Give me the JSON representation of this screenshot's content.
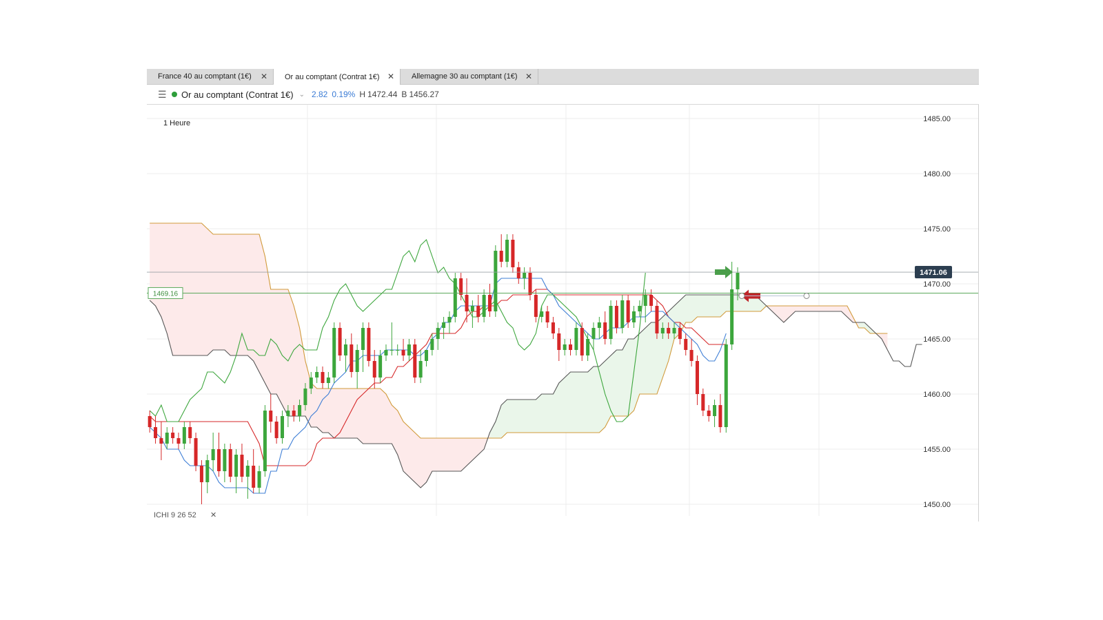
{
  "tabs": [
    {
      "label": "France 40 au comptant (1€)",
      "close": "✕",
      "active": false
    },
    {
      "label": "Or au comptant (Contrat 1€)",
      "close": "✕",
      "active": true
    },
    {
      "label": "Allemagne 30 au comptant (1€)",
      "close": "✕",
      "active": false
    }
  ],
  "header": {
    "menu_icon": "☰",
    "instrument": "Or au comptant (Contrat 1€)",
    "chevron": "⌄",
    "change": "2.82",
    "change_pct": "0.19%",
    "high_label": "H",
    "high": "1472.44",
    "low_label": "B",
    "low": "1456.27"
  },
  "timeframe": "1 Heure",
  "indicator": {
    "label": "ICHI 9 26 52",
    "close": "✕"
  },
  "chart_data": {
    "type": "candlestick",
    "ylim": [
      1450,
      1485
    ],
    "y_ticks": [
      "1485.00",
      "1480.00",
      "1475.00",
      "1470.00",
      "1465.00",
      "1460.00",
      "1455.00",
      "1450.00"
    ],
    "y_tick_values": [
      1485,
      1480,
      1475,
      1470,
      1465,
      1460,
      1455,
      1450
    ],
    "current_price": 1471.06,
    "current_price_label": "1471.06",
    "horizontal_line": 1469.16,
    "horizontal_line_label": "1469.16",
    "colors": {
      "up": "#3ca63c",
      "down": "#d62728",
      "tenkan": "#3f7fd6",
      "kijun": "#d62728",
      "chikou": "#3ca63c",
      "senkou_a": "#d19a3a",
      "senkou_b": "#555555",
      "cloud_bull": "#e8f5e8",
      "cloud_bear": "#fde8e8",
      "price_tag": "#2c3e50",
      "arrow_up": "#4a9e4a",
      "arrow_down": "#c0262b"
    },
    "candles": [
      [
        1458.0,
        1458.5,
        1456.5,
        1457.0
      ],
      [
        1457.0,
        1458.0,
        1455.5,
        1456.0
      ],
      [
        1456.0,
        1457.5,
        1454.0,
        1455.5
      ],
      [
        1455.5,
        1457.0,
        1455.0,
        1456.5
      ],
      [
        1456.5,
        1457.0,
        1455.5,
        1456.0
      ],
      [
        1456.0,
        1456.5,
        1455.0,
        1455.5
      ],
      [
        1455.5,
        1457.5,
        1455.0,
        1457.0
      ],
      [
        1457.0,
        1457.5,
        1455.5,
        1456.0
      ],
      [
        1456.0,
        1456.5,
        1453.0,
        1453.5
      ],
      [
        1453.5,
        1454.0,
        1450.0,
        1452.0
      ],
      [
        1452.0,
        1454.5,
        1451.0,
        1454.0
      ],
      [
        1454.0,
        1456.5,
        1453.0,
        1455.0
      ],
      [
        1455.0,
        1456.5,
        1452.5,
        1453.0
      ],
      [
        1453.0,
        1455.5,
        1452.0,
        1455.0
      ],
      [
        1455.0,
        1455.5,
        1452.0,
        1452.5
      ],
      [
        1452.5,
        1455.0,
        1451.0,
        1454.5
      ],
      [
        1454.5,
        1455.5,
        1452.0,
        1452.5
      ],
      [
        1452.5,
        1454.0,
        1450.5,
        1453.5
      ],
      [
        1453.5,
        1455.0,
        1451.0,
        1451.5
      ],
      [
        1451.5,
        1453.5,
        1451.0,
        1453.0
      ],
      [
        1453.0,
        1459.0,
        1452.5,
        1458.5
      ],
      [
        1458.5,
        1460.0,
        1456.5,
        1457.5
      ],
      [
        1457.5,
        1458.0,
        1455.5,
        1456.0
      ],
      [
        1456.0,
        1458.5,
        1455.5,
        1458.0
      ],
      [
        1458.0,
        1459.0,
        1457.0,
        1458.5
      ],
      [
        1458.5,
        1459.0,
        1457.5,
        1458.0
      ],
      [
        1458.0,
        1459.5,
        1457.5,
        1459.0
      ],
      [
        1459.0,
        1461.0,
        1458.5,
        1460.5
      ],
      [
        1460.5,
        1462.0,
        1460.0,
        1461.5
      ],
      [
        1461.5,
        1462.5,
        1461.0,
        1462.0
      ],
      [
        1462.0,
        1462.5,
        1460.5,
        1461.0
      ],
      [
        1461.0,
        1462.0,
        1460.5,
        1461.5
      ],
      [
        1461.5,
        1466.5,
        1461.0,
        1466.0
      ],
      [
        1466.0,
        1466.5,
        1463.0,
        1463.5
      ],
      [
        1463.5,
        1465.0,
        1462.0,
        1464.5
      ],
      [
        1464.5,
        1465.5,
        1461.5,
        1462.0
      ],
      [
        1462.0,
        1464.5,
        1460.5,
        1464.0
      ],
      [
        1464.0,
        1466.5,
        1462.0,
        1466.0
      ],
      [
        1466.0,
        1466.5,
        1462.5,
        1463.0
      ],
      [
        1463.0,
        1464.0,
        1460.5,
        1461.5
      ],
      [
        1461.5,
        1464.0,
        1461.0,
        1463.5
      ],
      [
        1463.5,
        1464.5,
        1463.0,
        1464.0
      ],
      [
        1464.0,
        1466.5,
        1463.5,
        1464.0
      ],
      [
        1464.0,
        1464.5,
        1463.5,
        1464.0
      ],
      [
        1464.0,
        1465.0,
        1463.0,
        1463.5
      ],
      [
        1463.5,
        1465.0,
        1463.0,
        1464.5
      ],
      [
        1464.5,
        1465.0,
        1461.0,
        1461.5
      ],
      [
        1461.5,
        1464.0,
        1461.0,
        1463.0
      ],
      [
        1463.0,
        1464.0,
        1462.5,
        1464.0
      ],
      [
        1464.0,
        1465.5,
        1463.5,
        1465.0
      ],
      [
        1465.0,
        1466.5,
        1464.0,
        1466.0
      ],
      [
        1466.0,
        1467.0,
        1465.0,
        1466.5
      ],
      [
        1466.5,
        1467.5,
        1465.5,
        1467.0
      ],
      [
        1467.0,
        1471.0,
        1466.5,
        1470.5
      ],
      [
        1470.5,
        1471.0,
        1468.5,
        1469.0
      ],
      [
        1469.0,
        1470.5,
        1466.5,
        1467.5
      ],
      [
        1467.5,
        1468.5,
        1466.0,
        1468.0
      ],
      [
        1468.0,
        1469.0,
        1466.5,
        1467.0
      ],
      [
        1467.0,
        1469.5,
        1466.5,
        1469.0
      ],
      [
        1469.0,
        1470.0,
        1467.0,
        1467.5
      ],
      [
        1467.5,
        1473.5,
        1467.0,
        1473.0
      ],
      [
        1473.0,
        1474.5,
        1471.5,
        1472.0
      ],
      [
        1472.0,
        1474.5,
        1471.5,
        1474.0
      ],
      [
        1474.0,
        1474.5,
        1471.0,
        1471.5
      ],
      [
        1471.5,
        1472.0,
        1470.0,
        1470.5
      ],
      [
        1470.5,
        1471.5,
        1469.5,
        1471.0
      ],
      [
        1471.0,
        1471.5,
        1468.5,
        1469.0
      ],
      [
        1469.0,
        1469.5,
        1466.5,
        1467.0
      ],
      [
        1467.0,
        1468.0,
        1466.5,
        1467.5
      ],
      [
        1467.5,
        1468.0,
        1466.0,
        1466.5
      ],
      [
        1466.5,
        1467.0,
        1465.0,
        1465.5
      ],
      [
        1465.5,
        1466.0,
        1463.0,
        1464.0
      ],
      [
        1464.0,
        1465.0,
        1463.5,
        1464.5
      ],
      [
        1464.5,
        1465.0,
        1463.5,
        1464.0
      ],
      [
        1464.0,
        1466.5,
        1463.5,
        1466.0
      ],
      [
        1466.0,
        1466.5,
        1463.0,
        1463.5
      ],
      [
        1463.5,
        1465.5,
        1463.0,
        1465.0
      ],
      [
        1465.0,
        1466.5,
        1464.0,
        1466.0
      ],
      [
        1466.0,
        1467.0,
        1465.0,
        1466.5
      ],
      [
        1466.5,
        1467.5,
        1464.5,
        1465.0
      ],
      [
        1465.0,
        1468.5,
        1464.5,
        1468.0
      ],
      [
        1468.0,
        1468.5,
        1465.5,
        1466.0
      ],
      [
        1466.0,
        1469.0,
        1465.5,
        1468.5
      ],
      [
        1468.5,
        1469.0,
        1466.0,
        1466.5
      ],
      [
        1466.5,
        1468.0,
        1466.0,
        1467.5
      ],
      [
        1467.5,
        1468.5,
        1467.0,
        1468.0
      ],
      [
        1468.0,
        1469.5,
        1466.5,
        1469.0
      ],
      [
        1469.0,
        1469.5,
        1467.5,
        1468.0
      ],
      [
        1468.0,
        1468.5,
        1465.0,
        1465.5
      ],
      [
        1465.5,
        1466.5,
        1465.0,
        1466.0
      ],
      [
        1466.0,
        1466.5,
        1465.0,
        1465.5
      ],
      [
        1465.5,
        1466.5,
        1465.0,
        1466.0
      ],
      [
        1466.0,
        1466.5,
        1464.5,
        1465.0
      ],
      [
        1465.0,
        1465.5,
        1463.5,
        1464.0
      ],
      [
        1464.0,
        1465.0,
        1462.5,
        1463.0
      ],
      [
        1463.0,
        1463.5,
        1459.0,
        1460.0
      ],
      [
        1460.0,
        1460.5,
        1458.0,
        1458.5
      ],
      [
        1458.5,
        1459.0,
        1457.5,
        1458.0
      ],
      [
        1458.0,
        1459.5,
        1457.0,
        1459.0
      ],
      [
        1459.0,
        1460.0,
        1456.5,
        1457.0
      ],
      [
        1457.0,
        1465.0,
        1456.5,
        1464.5
      ],
      [
        1464.5,
        1472.0,
        1464.0,
        1469.5
      ],
      [
        1469.5,
        1471.5,
        1468.5,
        1471.0
      ]
    ],
    "tenkan": [
      1457,
      1456.5,
      1456,
      1455,
      1455,
      1455,
      1454,
      1453.5,
      1453.5,
      1453.5,
      1453.5,
      1453,
      1452,
      1451.5,
      1451.5,
      1451.5,
      1451.5,
      1451.5,
      1451,
      1451,
      1451,
      1453,
      1453,
      1455,
      1455,
      1456,
      1456.5,
      1457,
      1458,
      1458.5,
      1459.5,
      1460,
      1461,
      1461.5,
      1462,
      1463,
      1463,
      1463.5,
      1463.5,
      1463.5,
      1463.5,
      1464,
      1464,
      1464,
      1464,
      1464,
      1463.5,
      1463.5,
      1464,
      1465,
      1465.5,
      1466.5,
      1466.5,
      1467.5,
      1468,
      1468,
      1468,
      1468,
      1468,
      1468,
      1470,
      1470.5,
      1470.5,
      1470.5,
      1470.5,
      1470.5,
      1470.5,
      1470.5,
      1470.5,
      1469.5,
      1469,
      1468,
      1467.5,
      1467,
      1466.5,
      1466,
      1465.5,
      1465,
      1465,
      1465.5,
      1466,
      1466,
      1466,
      1466.5,
      1467,
      1467,
      1467,
      1467.5,
      1467.5,
      1467.5,
      1467,
      1466.5,
      1466,
      1465.5,
      1465,
      1464.5,
      1463.5,
      1463,
      1463,
      1464,
      1465.5
    ],
    "kijun": [
      1458,
      1457.5,
      1457.5,
      1457.5,
      1457.5,
      1457.5,
      1457.5,
      1457.5,
      1457.5,
      1457.5,
      1457.5,
      1457.5,
      1457.5,
      1457.5,
      1457.5,
      1457.5,
      1457.5,
      1457.5,
      1456.5,
      1455.5,
      1453.5,
      1453.5,
      1453.5,
      1453.5,
      1453.5,
      1453.5,
      1453.5,
      1453.5,
      1454,
      1455.5,
      1456,
      1456,
      1456,
      1456.5,
      1457.5,
      1458.5,
      1459.5,
      1460,
      1460.5,
      1461,
      1461,
      1461.5,
      1461.5,
      1462.5,
      1462.5,
      1463,
      1463.5,
      1464,
      1464.5,
      1465.5,
      1465.5,
      1465.5,
      1465.5,
      1465.5,
      1466,
      1467,
      1467.5,
      1467.5,
      1468,
      1468,
      1468,
      1468.5,
      1468.5,
      1469,
      1469,
      1469,
      1469,
      1469.5,
      1469.5,
      1469.5,
      1469,
      1469,
      1469,
      1469,
      1469,
      1469,
      1469,
      1469,
      1469,
      1469,
      1469,
      1469,
      1469,
      1469,
      1469,
      1469,
      1469,
      1469,
      1468.5,
      1468,
      1467,
      1466.5,
      1466.5,
      1466,
      1466,
      1465.5,
      1465,
      1464.5,
      1464.5,
      1464.5,
      1464.5
    ],
    "chikou_offset": -26,
    "chikou": [
      1458.5,
      1458,
      1459,
      1457.5,
      1457.5,
      1457.5,
      1458.5,
      1459.5,
      1460,
      1460.5,
      1462,
      1462,
      1461.5,
      1461,
      1462,
      1463.5,
      1465.5,
      1464,
      1464,
      1463.5,
      1463.5,
      1465,
      1464.5,
      1463.5,
      1463,
      1464,
      1464.5,
      1464,
      1464,
      1464,
      1466,
      1467,
      1468.5,
      1469.5,
      1470,
      1469,
      1468,
      1467.5,
      1468,
      1468.5,
      1469,
      1469.5,
      1469.5,
      1471,
      1472.5,
      1473,
      1472,
      1473.5,
      1474,
      1472.5,
      1471,
      1471.5,
      1470.5,
      1470,
      1469,
      1468,
      1467,
      1467,
      1467.5,
      1468,
      1468.5,
      1467.5,
      1466.5,
      1466,
      1464.5,
      1464,
      1464.5,
      1465.5,
      1468,
      1469,
      1469,
      1468.5,
      1468,
      1467.5,
      1467,
      1466,
      1465,
      1464,
      1462,
      1460,
      1458.5,
      1457.5,
      1457.5,
      1458,
      1462,
      1466,
      1471
    ],
    "senkou_a_offset": 0,
    "senkou_a": [
      1475.5,
      1475.5,
      1475.5,
      1475.5,
      1475.5,
      1475.5,
      1475.5,
      1475.5,
      1475.5,
      1475.5,
      1475,
      1474.5,
      1474.5,
      1474.5,
      1474.5,
      1474.5,
      1474.5,
      1474.5,
      1474.5,
      1474.5,
      1472.5,
      1469.5,
      1469.5,
      1469.5,
      1469.5,
      1468,
      1466,
      1463,
      1461,
      1460.5,
      1460.5,
      1460.5,
      1460.5,
      1460.5,
      1460.5,
      1460.5,
      1460.5,
      1460.5,
      1460.5,
      1460.5,
      1460.5,
      1460,
      1459,
      1458.5,
      1457.5,
      1457,
      1456.5,
      1456,
      1456,
      1456,
      1456,
      1456,
      1456,
      1456,
      1456,
      1456,
      1456,
      1456,
      1456,
      1456,
      1456,
      1456,
      1456.5,
      1456.5,
      1456.5,
      1456.5,
      1456.5,
      1456.5,
      1456.5,
      1456.5,
      1456.5,
      1456.5,
      1456.5,
      1456.5,
      1456.5,
      1456.5,
      1456.5,
      1456.5,
      1456.5,
      1457,
      1458,
      1458,
      1458,
      1458,
      1458.5,
      1460,
      1460,
      1460,
      1460,
      1461.5,
      1463,
      1465,
      1465.5,
      1466.5,
      1466.5,
      1467,
      1467,
      1467,
      1467,
      1467,
      1467.5,
      1467.5,
      1467.5,
      1467.5,
      1467.5,
      1467.5,
      1467.5,
      1468,
      1468,
      1468,
      1468,
      1468,
      1468,
      1468,
      1468,
      1468,
      1468,
      1468,
      1468,
      1468,
      1468,
      1468,
      1467,
      1466,
      1466,
      1465.5,
      1465.5,
      1465.5,
      1465.5
    ],
    "senkou_b_offset": 0,
    "senkou_b": [
      1468.5,
      1468,
      1467,
      1465.5,
      1463.5,
      1463.5,
      1463.5,
      1463.5,
      1463.5,
      1463.5,
      1463.5,
      1464,
      1464,
      1464,
      1463.5,
      1463.5,
      1463.5,
      1463.5,
      1463,
      1462,
      1461,
      1460,
      1460,
      1459,
      1458,
      1458,
      1458,
      1458,
      1457,
      1457,
      1456.5,
      1456.5,
      1456,
      1456,
      1456,
      1456,
      1456,
      1455.5,
      1455.5,
      1455.5,
      1455.5,
      1455.5,
      1455.5,
      1454.5,
      1453,
      1452.5,
      1452,
      1451.5,
      1452,
      1453,
      1453,
      1453,
      1453,
      1453,
      1453,
      1453.5,
      1454,
      1454.5,
      1455,
      1456.5,
      1457.5,
      1459,
      1459.5,
      1459.5,
      1459.5,
      1459.5,
      1459.5,
      1459.5,
      1460,
      1460,
      1460,
      1461,
      1461.5,
      1462,
      1462,
      1462,
      1462,
      1462.5,
      1462.5,
      1463,
      1463.5,
      1464,
      1464,
      1465,
      1465,
      1465.5,
      1466,
      1466.5,
      1466.5,
      1467,
      1467.5,
      1468,
      1468.5,
      1469,
      1469,
      1469,
      1469,
      1469,
      1469,
      1469,
      1469,
      1469,
      1469,
      1469,
      1469,
      1469,
      1468.5,
      1468,
      1467.5,
      1467,
      1466.5,
      1467,
      1467.5,
      1467.5,
      1467.5,
      1467.5,
      1467.5,
      1467.5,
      1467.5,
      1467.5,
      1467.5,
      1467,
      1466.5,
      1466.5,
      1466.5,
      1466,
      1465.5,
      1465,
      1464,
      1463,
      1463,
      1462.5,
      1462.5,
      1464.5,
      1464.5
    ],
    "n_slots": 133
  }
}
